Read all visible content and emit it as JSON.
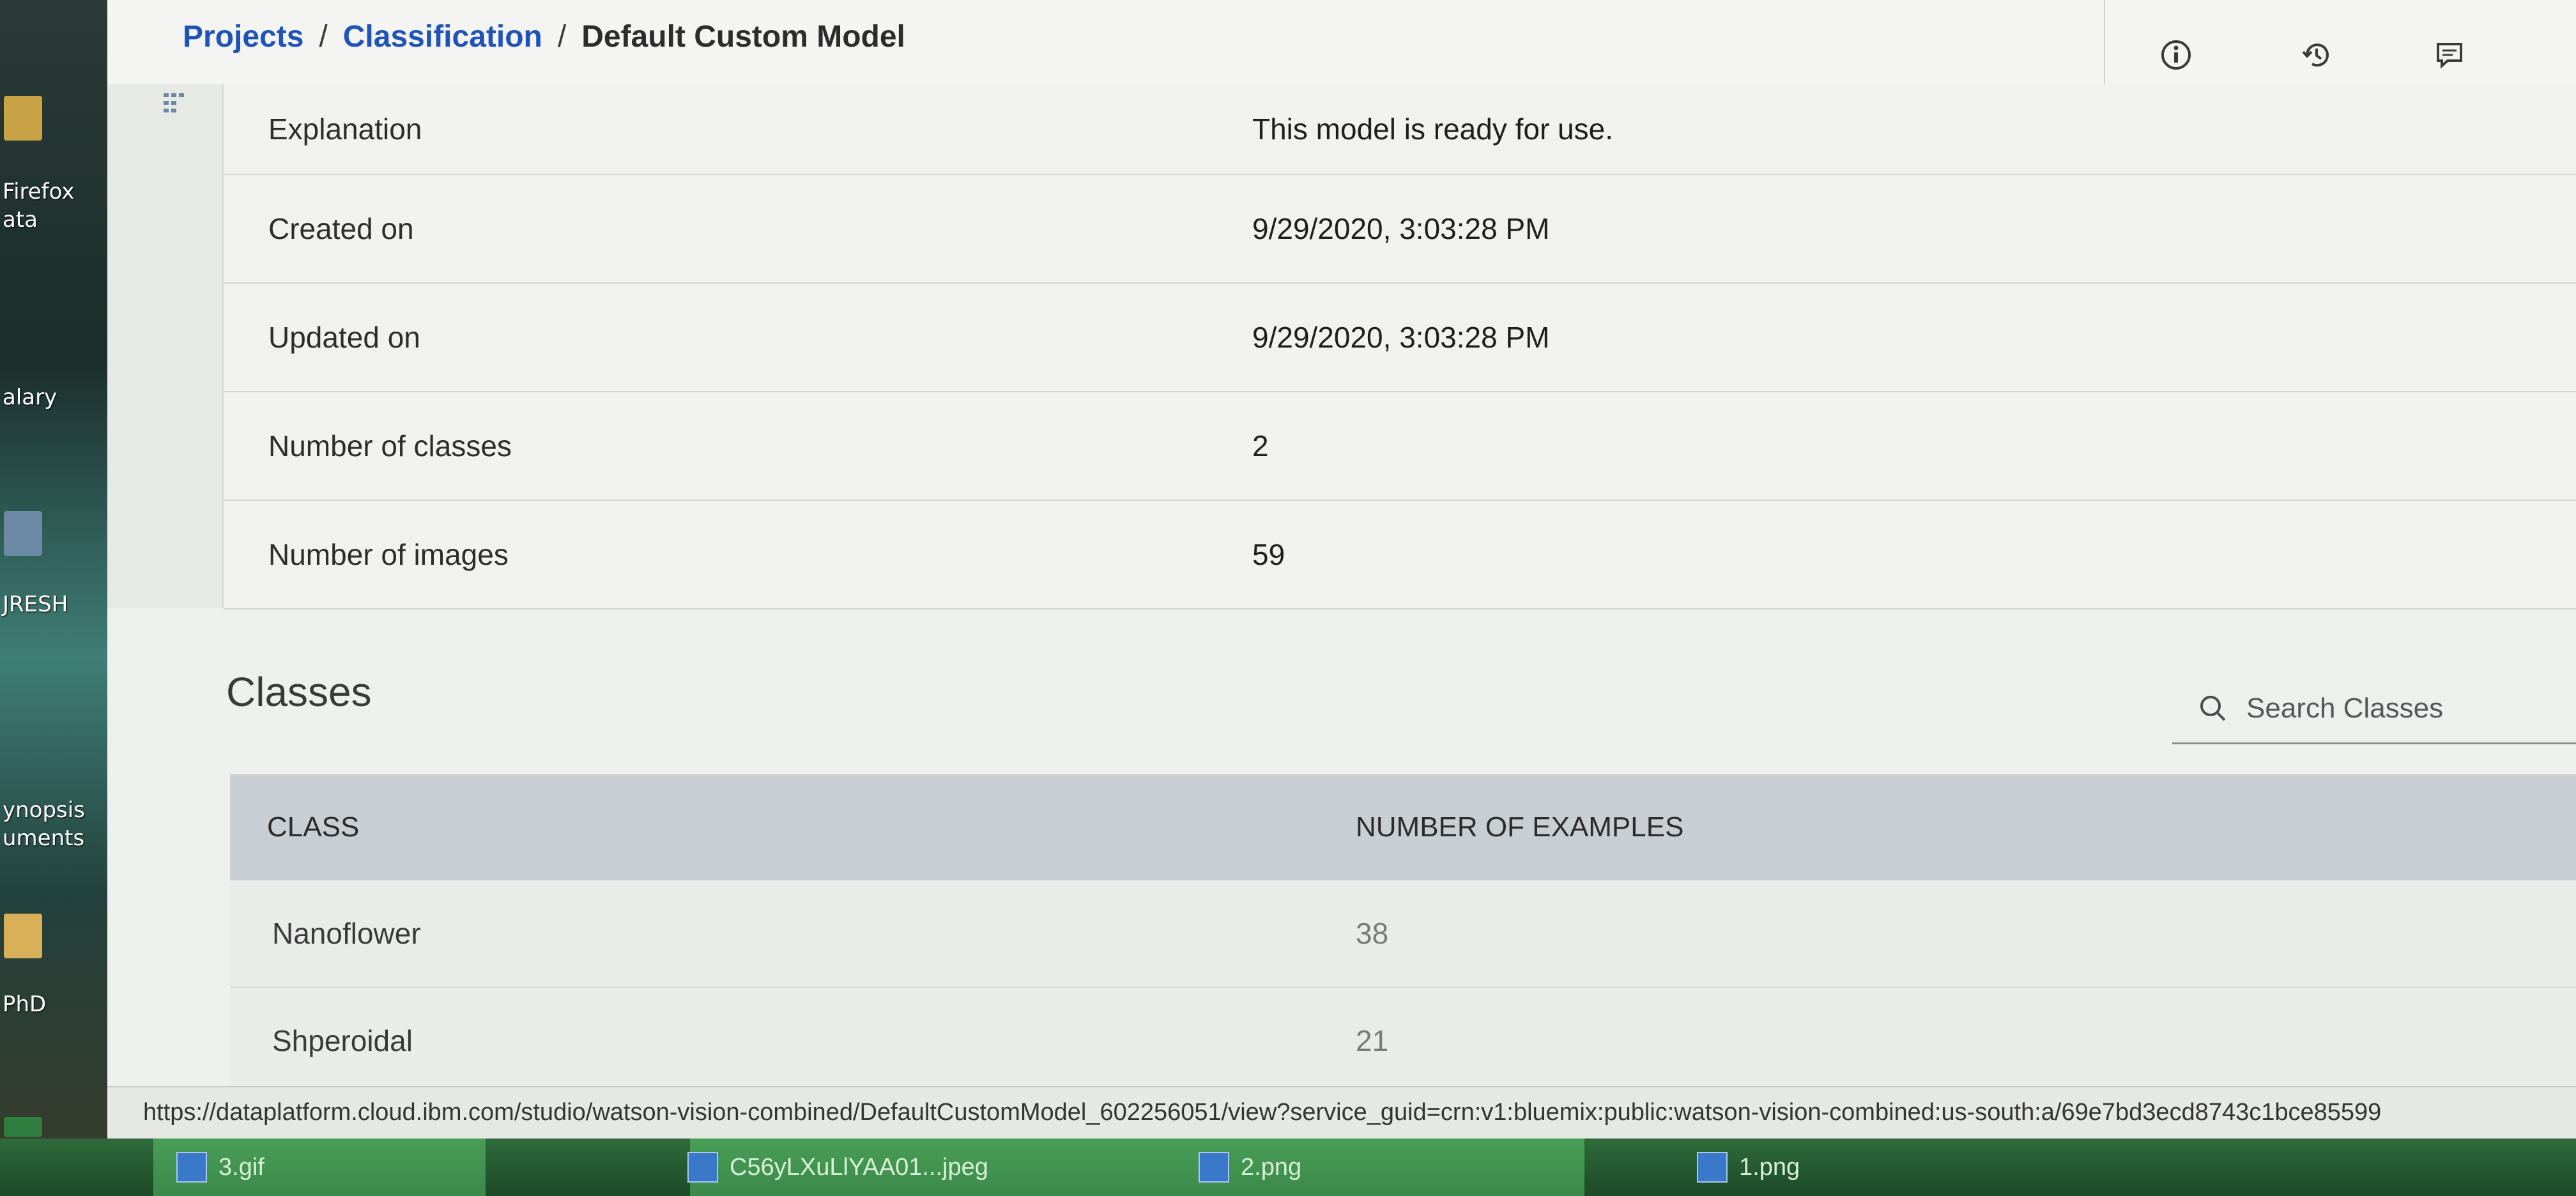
{
  "desktop": {
    "icons": [
      {
        "label": "Firefox\nata"
      },
      {
        "label": "alary"
      },
      {
        "label": "JRESH"
      },
      {
        "label": "ynopsis\numents"
      },
      {
        "label": "PhD"
      }
    ]
  },
  "breadcrumb": {
    "items": [
      "Projects",
      "Classification"
    ],
    "separator": "/",
    "current": "Default Custom Model"
  },
  "header_icons": [
    "info-icon",
    "history-icon",
    "feedback-icon"
  ],
  "details": [
    {
      "label": "Explanation",
      "value": "This model is ready for use."
    },
    {
      "label": "Created on",
      "value": "9/29/2020, 3:03:28 PM"
    },
    {
      "label": "Updated on",
      "value": "9/29/2020, 3:03:28 PM"
    },
    {
      "label": "Number of classes",
      "value": "2"
    },
    {
      "label": "Number of images",
      "value": "59"
    }
  ],
  "classes": {
    "title": "Classes",
    "search_placeholder": "Search Classes",
    "columns": [
      "CLASS",
      "NUMBER OF EXAMPLES"
    ],
    "rows": [
      {
        "class": "Nanoflower",
        "examples": "38"
      },
      {
        "class": "Shperoidal",
        "examples": "21"
      }
    ]
  },
  "status_url": "https://dataplatform.cloud.ibm.com/studio/watson-vision-combined/DefaultCustomModel_602256051/view?service_guid=crn:v1:bluemix:public:watson-vision-combined:us-south:a/69e7bd3ecd8743c1bce85599",
  "taskbar": {
    "items": [
      {
        "label": "3.gif"
      },
      {
        "label": "C56yLXuLlYAA01...jpeg"
      },
      {
        "label": "2.png"
      },
      {
        "label": "1.png"
      }
    ]
  },
  "colors": {
    "link": "#1f53b8",
    "table_header": "#c9ced2",
    "taskbar": "#2f6b3a"
  }
}
